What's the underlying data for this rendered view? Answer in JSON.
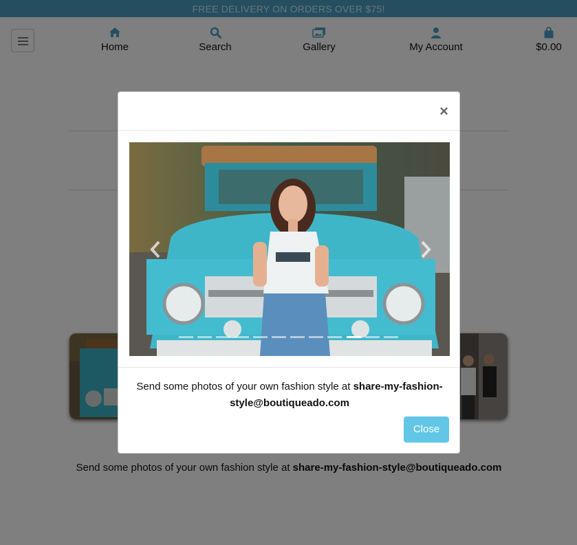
{
  "banner": {
    "text": "FREE DELIVERY ON ORDERS OVER $75!"
  },
  "nav": {
    "items": [
      {
        "label": "Home",
        "icon": "home-icon"
      },
      {
        "label": "Search",
        "icon": "search-icon"
      },
      {
        "label": "Gallery",
        "icon": "gallery-icon"
      },
      {
        "label": "My Account",
        "icon": "user-icon"
      },
      {
        "label": "$0.00",
        "icon": "shopping-bag-icon"
      }
    ]
  },
  "page": {
    "caption_text": "Send some photos of your own fashion style at ",
    "caption_email": "share-my-fashion-style@boutiqueado.com"
  },
  "modal": {
    "close_symbol": "×",
    "caption_text": "Send some photos of your own fashion style at ",
    "caption_email": "share-my-fashion-style@boutiqueado.com",
    "close_button_label": "Close",
    "carousel": {
      "slide_count": 12,
      "active_index": 9
    }
  },
  "colors": {
    "banner": "#4b9fc3",
    "accent_icon": "#4b9fc3",
    "close_button": "#62c6e6"
  }
}
